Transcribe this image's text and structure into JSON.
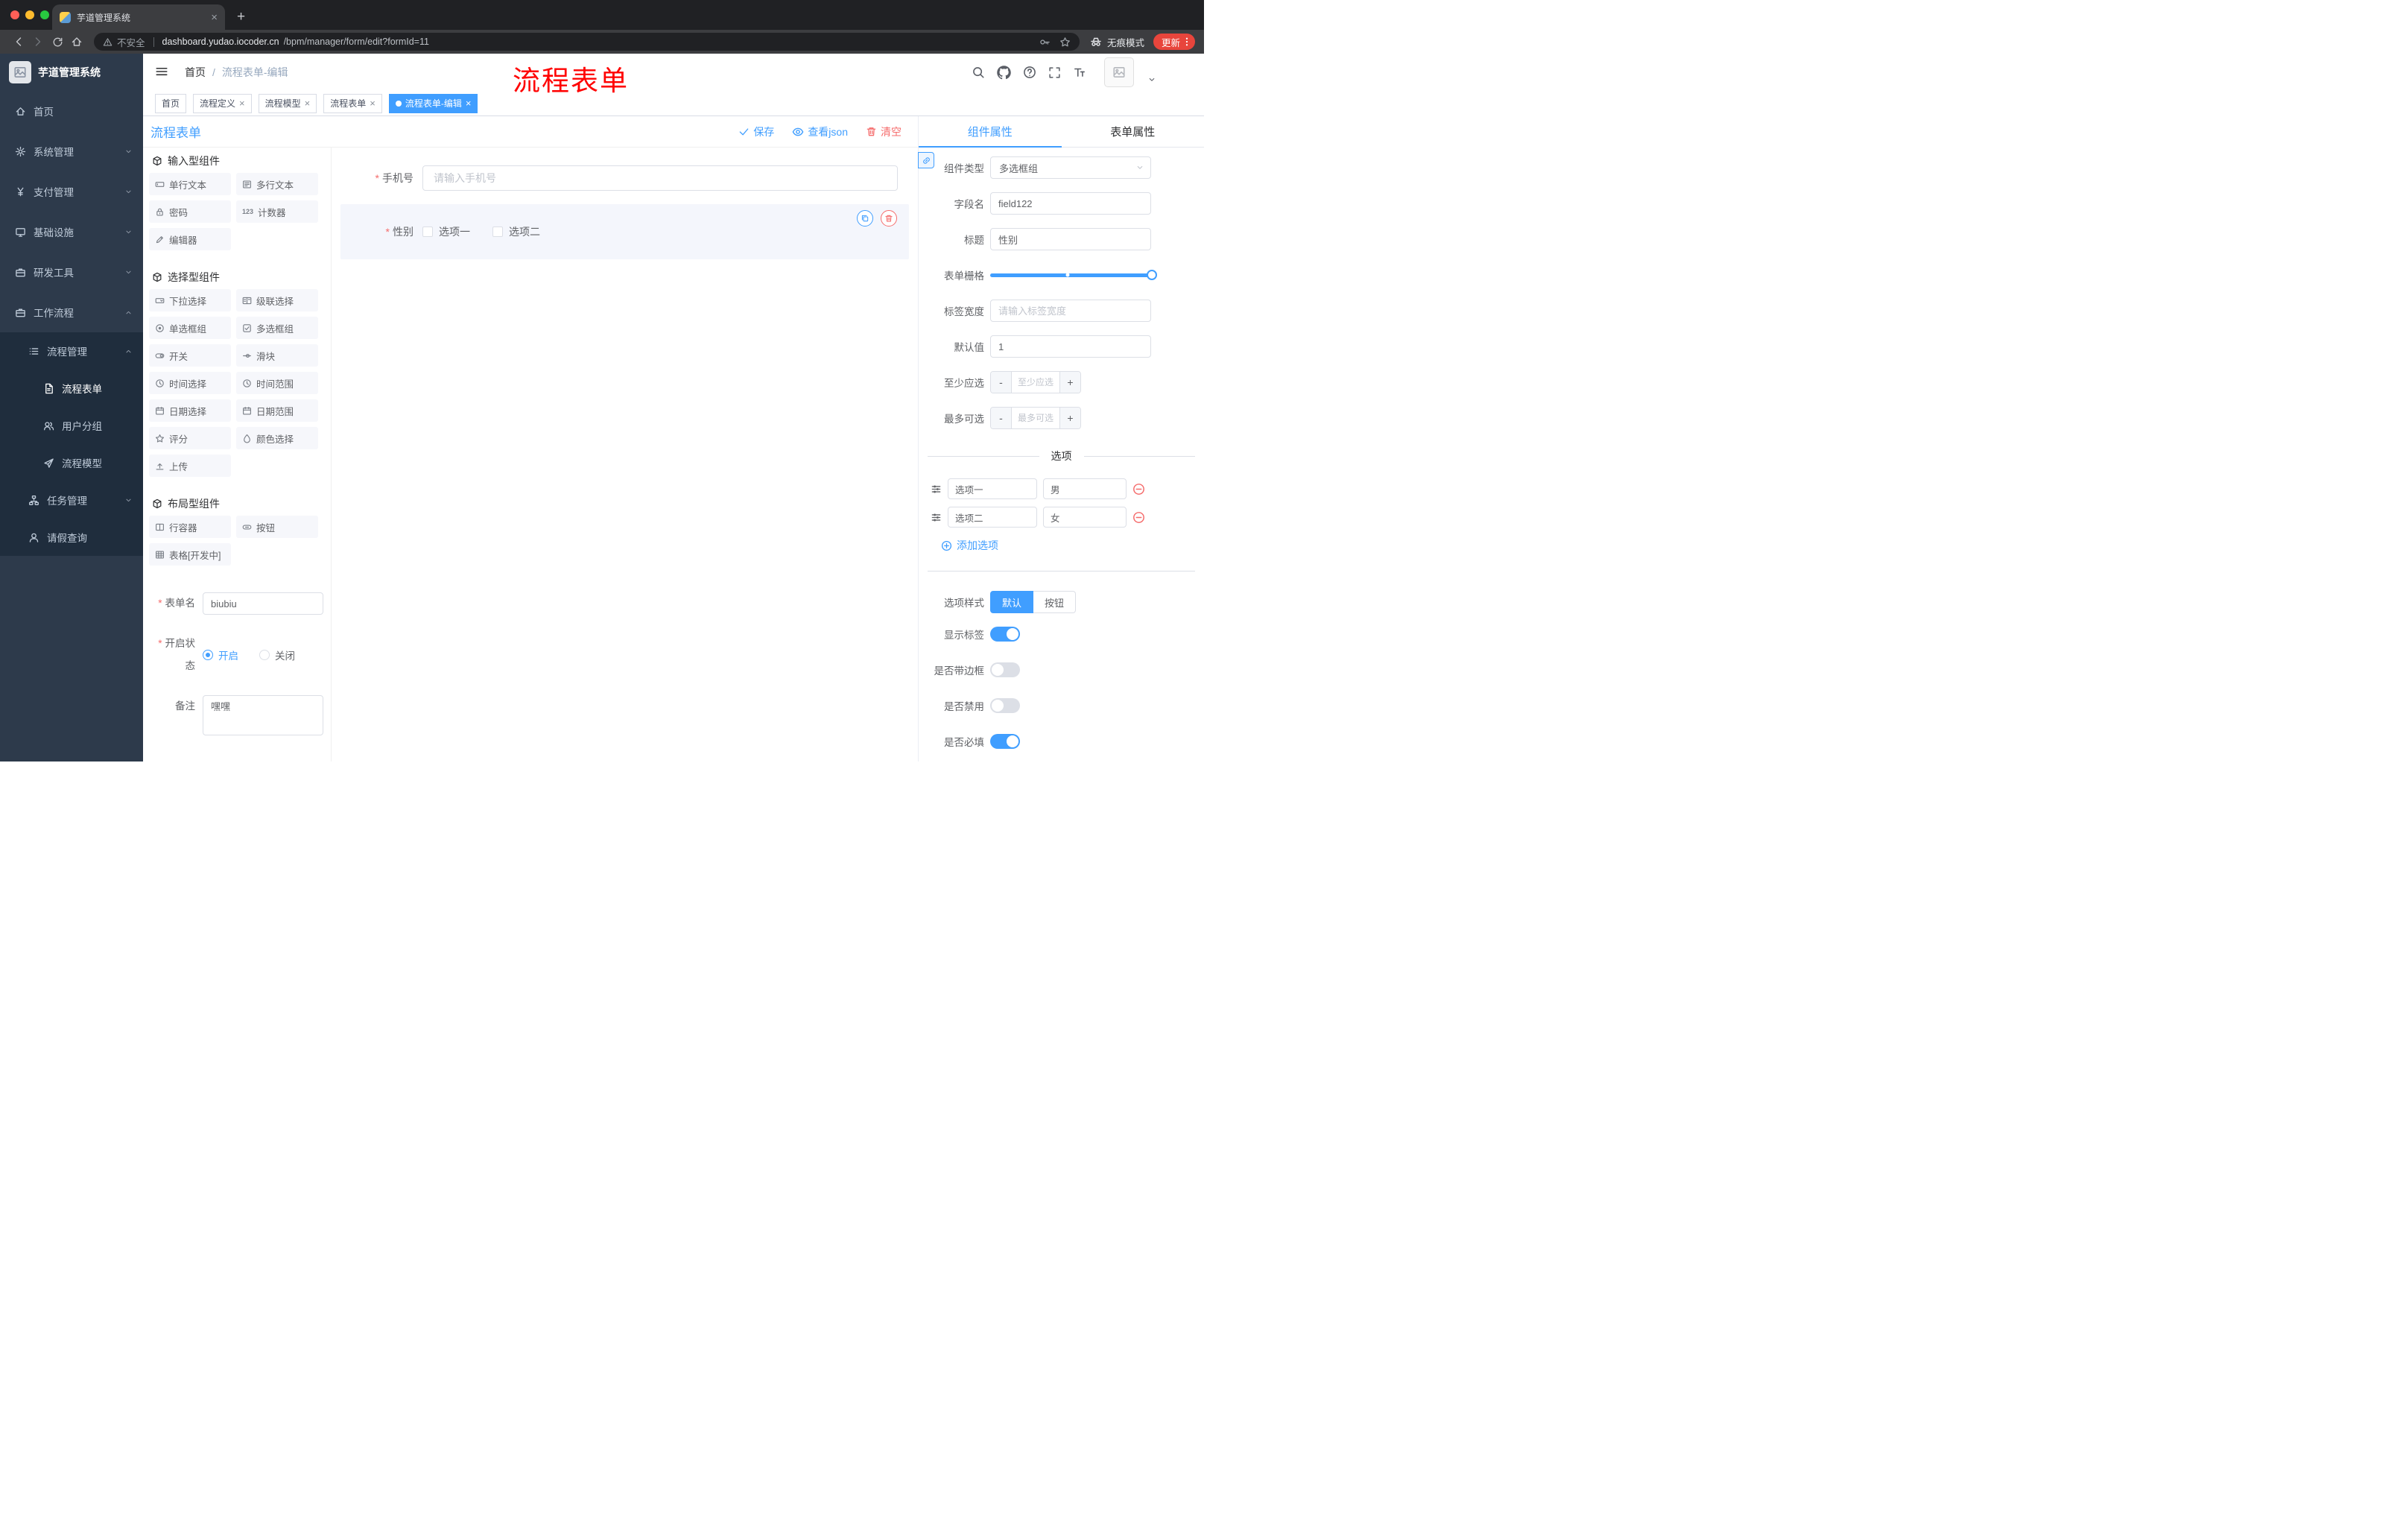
{
  "theme": {
    "accent": "#409EFF",
    "danger": "#F56C6C",
    "sidebar_bg": "#2d3a4b",
    "annotation_red": "#ff0000",
    "active_tag_bg": "#409EFF"
  },
  "browser": {
    "tab_title": "芋道管理系统",
    "security": "不安全",
    "url_host": "dashboard.yudao.iocoder.cn",
    "url_path": "/bpm/manager/form/edit?formId=11",
    "incognito": "无痕模式",
    "update": "更新"
  },
  "sidebar": {
    "logo": "芋道管理系统",
    "items": [
      {
        "label": "首页",
        "icon": "home-icon"
      },
      {
        "label": "系统管理",
        "icon": "gear-icon",
        "arrow": "down"
      },
      {
        "label": "支付管理",
        "icon": "yen-icon",
        "arrow": "down"
      },
      {
        "label": "基础设施",
        "icon": "monitor-icon",
        "arrow": "down"
      },
      {
        "label": "研发工具",
        "icon": "briefcase-icon",
        "arrow": "down"
      },
      {
        "label": "工作流程",
        "icon": "workflow-icon",
        "arrow": "up"
      },
      {
        "label": "流程管理",
        "icon": "list-icon",
        "arrow": "up"
      },
      {
        "label": "流程表单",
        "icon": "document-icon",
        "active": true
      },
      {
        "label": "用户分组",
        "icon": "users-icon"
      },
      {
        "label": "流程模型",
        "icon": "send-icon"
      },
      {
        "label": "任务管理",
        "icon": "tree-icon",
        "arrow": "down"
      },
      {
        "label": "请假查询",
        "icon": "user-icon"
      }
    ]
  },
  "header": {
    "breadcrumb": {
      "home": "首页",
      "separator": "/",
      "current": "流程表单-编辑"
    },
    "annotation": "流程表单"
  },
  "tags": {
    "items": [
      {
        "label": "首页",
        "closable": false,
        "active": false
      },
      {
        "label": "流程定义",
        "closable": true,
        "active": false
      },
      {
        "label": "流程模型",
        "closable": true,
        "active": false
      },
      {
        "label": "流程表单",
        "closable": true,
        "active": false
      },
      {
        "label": "流程表单-编辑",
        "closable": true,
        "active": true
      }
    ]
  },
  "designer": {
    "title": "流程表单",
    "toolbar": {
      "save": "保存",
      "view_json": "查看json",
      "clear": "清空"
    },
    "palette": {
      "sections": [
        {
          "title": "输入型组件",
          "items": [
            {
              "label": "单行文本",
              "icon": "input-icon"
            },
            {
              "label": "多行文本",
              "icon": "textarea-icon"
            },
            {
              "label": "密码",
              "icon": "password-icon"
            },
            {
              "label": "计数器",
              "icon": "counter-icon",
              "icon_text": "123"
            },
            {
              "label": "编辑器",
              "icon": "editor-icon"
            }
          ]
        },
        {
          "title": "选择型组件",
          "items": [
            {
              "label": "下拉选择",
              "icon": "select-icon"
            },
            {
              "label": "级联选择",
              "icon": "cascader-icon"
            },
            {
              "label": "单选框组",
              "icon": "radio-icon"
            },
            {
              "label": "多选框组",
              "icon": "checkbox-icon"
            },
            {
              "label": "开关",
              "icon": "switch-icon"
            },
            {
              "label": "滑块",
              "icon": "slider-icon"
            },
            {
              "label": "时间选择",
              "icon": "time-icon"
            },
            {
              "label": "时间范围",
              "icon": "time-range-icon"
            },
            {
              "label": "日期选择",
              "icon": "date-icon"
            },
            {
              "label": "日期范围",
              "icon": "date-range-icon"
            },
            {
              "label": "评分",
              "icon": "rate-icon"
            },
            {
              "label": "颜色选择",
              "icon": "color-icon"
            },
            {
              "label": "上传",
              "icon": "upload-icon"
            }
          ]
        },
        {
          "title": "布局型组件",
          "items": [
            {
              "label": "行容器",
              "icon": "row-icon"
            },
            {
              "label": "按钮",
              "icon": "button-icon"
            },
            {
              "label": "表格[开发中]",
              "icon": "table-icon"
            }
          ]
        }
      ]
    },
    "meta": {
      "form_name": {
        "label": "表单名",
        "value": "biubiu",
        "required": true
      },
      "status": {
        "label": "开启状态",
        "required": true,
        "options": [
          "开启",
          "关闭"
        ],
        "selected": "开启"
      },
      "remark": {
        "label": "备注",
        "value": "嘿嘿"
      }
    },
    "canvas": {
      "phone": {
        "label": "手机号",
        "required": true,
        "placeholder": "请输入手机号"
      },
      "gender": {
        "label": "性别",
        "required": true,
        "options": [
          "选项一",
          "选项二"
        ],
        "selected": true
      }
    }
  },
  "props": {
    "tabs": {
      "component": "组件属性",
      "form": "表单属性",
      "active": "组件属性"
    },
    "rows": {
      "component_type": {
        "label": "组件类型",
        "value": "多选框组"
      },
      "field_name": {
        "label": "字段名",
        "value": "field122"
      },
      "title": {
        "label": "标题",
        "value": "性别"
      },
      "grid": {
        "label": "表单栅格",
        "value_percent": 100
      },
      "label_width": {
        "label": "标签宽度",
        "placeholder": "请输入标签宽度"
      },
      "default_value": {
        "label": "默认值",
        "value": "1"
      },
      "min_select": {
        "label": "至少应选",
        "placeholder": "至少应选"
      },
      "max_select": {
        "label": "最多可选",
        "placeholder": "最多可选"
      }
    },
    "options": {
      "divider": "选项",
      "rows": [
        {
          "label": "选项一",
          "value": "男"
        },
        {
          "label": "选项二",
          "value": "女"
        }
      ],
      "add": "添加选项"
    },
    "style": {
      "label": "选项样式",
      "choices": [
        "默认",
        "按钮"
      ],
      "selected": "默认"
    },
    "switches": [
      {
        "label": "显示标签",
        "on": true
      },
      {
        "label": "是否带边框",
        "on": false
      },
      {
        "label": "是否禁用",
        "on": false
      },
      {
        "label": "是否必填",
        "on": true
      }
    ]
  }
}
